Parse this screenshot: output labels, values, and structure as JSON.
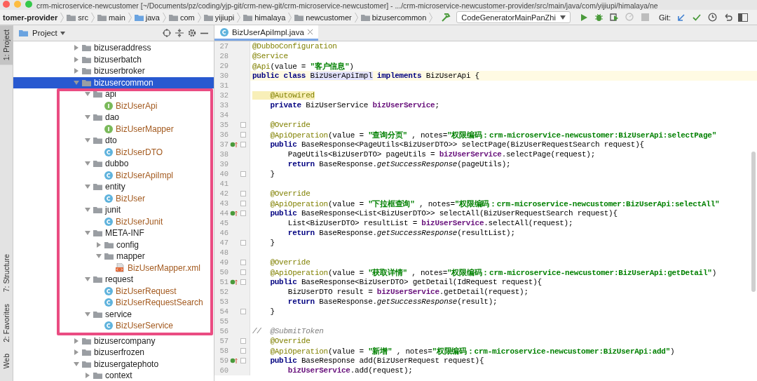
{
  "title_bar": {
    "title": "crm-microservice-newcustomer [~/Documents/pz/coding/yjp-git/crm-new-git/crm-microservice-newcustomer] - .../crm-microservice-newcustomer-provider/src/main/java/com/yijiupi/himalaya/ne"
  },
  "nav_bar": {
    "breadcrumbs": [
      {
        "label": "tomer-provider",
        "kind": "module"
      },
      {
        "label": "src",
        "kind": "folder"
      },
      {
        "label": "main",
        "kind": "folder"
      },
      {
        "label": "java",
        "kind": "source"
      },
      {
        "label": "com",
        "kind": "folder"
      },
      {
        "label": "yijiupi",
        "kind": "folder"
      },
      {
        "label": "himalaya",
        "kind": "folder"
      },
      {
        "label": "newcustomer",
        "kind": "folder"
      },
      {
        "label": "bizusercommon",
        "kind": "folder"
      }
    ],
    "run_config": "CodeGeneratorMainPanZhi",
    "run_tools": [
      {
        "kind": "run",
        "disabled": false
      },
      {
        "kind": "debug",
        "disabled": false
      },
      {
        "kind": "coverage",
        "disabled": false
      },
      {
        "kind": "profile",
        "disabled": true
      },
      {
        "kind": "stop",
        "disabled": true
      }
    ],
    "git_label": "Git:",
    "git_tools": [
      {
        "kind": "update"
      },
      {
        "kind": "commit"
      },
      {
        "kind": "history"
      },
      {
        "kind": "revert"
      },
      {
        "kind": "layout"
      }
    ]
  },
  "side_tabs": [
    {
      "label": "1: Project",
      "selected": true
    },
    {
      "label": "7: Structure",
      "selected": false
    },
    {
      "label": "2: Favorites",
      "selected": false
    },
    {
      "label": "Web",
      "selected": false
    }
  ],
  "project": {
    "title": "Project",
    "tree": [
      {
        "label": "bizuseraddress",
        "kind": "folder",
        "expanded": false,
        "selected": false
      },
      {
        "label": "bizuserbatch",
        "kind": "folder",
        "expanded": false,
        "selected": false
      },
      {
        "label": "bizuserbroker",
        "kind": "folder",
        "expanded": false,
        "selected": false
      },
      {
        "label": "bizusercommon",
        "kind": "folder",
        "expanded": true,
        "selected": true,
        "highlighted": true,
        "children": [
          {
            "label": "api",
            "kind": "folder",
            "expanded": true,
            "selected": false,
            "children": [
              {
                "label": "BizUserApi",
                "kind": "interface",
                "selected": false
              }
            ]
          },
          {
            "label": "dao",
            "kind": "folder",
            "expanded": true,
            "selected": false,
            "children": [
              {
                "label": "BizUserMapper",
                "kind": "interface",
                "selected": false
              }
            ]
          },
          {
            "label": "dto",
            "kind": "folder",
            "expanded": true,
            "selected": false,
            "children": [
              {
                "label": "BizUserDTO",
                "kind": "class",
                "selected": false
              }
            ]
          },
          {
            "label": "dubbo",
            "kind": "folder",
            "expanded": true,
            "selected": false,
            "children": [
              {
                "label": "BizUserApiImpl",
                "kind": "class",
                "selected": false
              }
            ]
          },
          {
            "label": "entity",
            "kind": "folder",
            "expanded": true,
            "selected": false,
            "children": [
              {
                "label": "BizUser",
                "kind": "class",
                "selected": false
              }
            ]
          },
          {
            "label": "junit",
            "kind": "folder",
            "expanded": true,
            "selected": false,
            "children": [
              {
                "label": "BizUserJunit",
                "kind": "class",
                "selected": false
              }
            ]
          },
          {
            "label": "META-INF",
            "kind": "folder",
            "expanded": true,
            "selected": false,
            "children": [
              {
                "label": "config",
                "kind": "folder",
                "expanded": false,
                "selected": false
              },
              {
                "label": "mapper",
                "kind": "folder",
                "expanded": true,
                "selected": false,
                "children": [
                  {
                    "label": "BizUserMapper.xml",
                    "kind": "xml",
                    "selected": false
                  }
                ]
              }
            ]
          },
          {
            "label": "request",
            "kind": "folder",
            "expanded": true,
            "selected": false,
            "children": [
              {
                "label": "BizUserRequest",
                "kind": "class",
                "selected": false
              },
              {
                "label": "BizUserRequestSearch",
                "kind": "class",
                "selected": false
              }
            ]
          },
          {
            "label": "service",
            "kind": "folder",
            "expanded": true,
            "selected": false,
            "children": [
              {
                "label": "BizUserService",
                "kind": "class",
                "selected": false
              }
            ]
          }
        ]
      },
      {
        "label": "bizusercompany",
        "kind": "folder",
        "expanded": false,
        "selected": false
      },
      {
        "label": "bizuserfrozen",
        "kind": "folder",
        "expanded": false,
        "selected": false
      },
      {
        "label": "bizusergatephoto",
        "kind": "folder",
        "expanded": true,
        "selected": false,
        "children": [
          {
            "label": "context",
            "kind": "folder",
            "expanded": false,
            "selected": false
          }
        ]
      }
    ]
  },
  "editor": {
    "tabs": [
      {
        "label": "BizUserApiImpl.java",
        "selected": true
      }
    ],
    "lines": [
      {
        "number": "27",
        "fold": false,
        "current": false,
        "tokens": [
          {
            "kind": "ann",
            "text": "@DubboConfiguration"
          }
        ]
      },
      {
        "number": "28",
        "fold": false,
        "current": false,
        "tokens": [
          {
            "kind": "ann",
            "text": "@Service"
          }
        ]
      },
      {
        "number": "29",
        "fold": false,
        "current": false,
        "tokens": [
          {
            "kind": "ann",
            "text": "@Api"
          },
          {
            "kind": "plain",
            "text": "(value = "
          },
          {
            "kind": "str",
            "text": "\"客户信息\""
          },
          {
            "kind": "plain",
            "text": ")"
          }
        ]
      },
      {
        "number": "30",
        "fold": false,
        "current": true,
        "tokens": [
          {
            "kind": "kw",
            "text": "public class "
          },
          {
            "kind": "ref",
            "text": "BizUserApiImpl"
          },
          {
            "kind": "kw",
            "text": " implements "
          },
          {
            "kind": "plain",
            "text": "BizUserApi {"
          }
        ]
      },
      {
        "number": "31",
        "fold": false,
        "current": false
      },
      {
        "number": "32",
        "fold": false,
        "current": false,
        "tokens": [
          {
            "kind": "flagged",
            "text": "    @Autowired"
          }
        ]
      },
      {
        "number": "33",
        "fold": false,
        "current": false,
        "tokens": [
          {
            "kind": "kw",
            "text": "    private "
          },
          {
            "kind": "plain",
            "text": "BizUserService "
          },
          {
            "kind": "field",
            "text": "bizUserService"
          },
          {
            "kind": "plain",
            "text": ";"
          }
        ]
      },
      {
        "number": "34",
        "fold": false,
        "current": false
      },
      {
        "number": "35",
        "fold": true,
        "current": false,
        "tokens": [
          {
            "kind": "ann",
            "text": "    @Override"
          }
        ]
      },
      {
        "number": "36",
        "fold": true,
        "current": false,
        "tokens": [
          {
            "kind": "ann",
            "text": "    @ApiOperation"
          },
          {
            "kind": "plain",
            "text": "(value = "
          },
          {
            "kind": "str",
            "text": "\"查询分页\""
          },
          {
            "kind": "plain",
            "text": " , notes="
          },
          {
            "kind": "str",
            "text": "\"权限编码：crm-microservice-newcustomer:BizUserApi:selectPage\""
          }
        ]
      },
      {
        "number": "37",
        "fold": true,
        "current": false,
        "override": true,
        "tokens": [
          {
            "kind": "kw",
            "text": "    public "
          },
          {
            "kind": "plain",
            "text": "BaseResponse<PageUtils<BizUserDTO>> selectPage(BizUserRequestSearch request){"
          }
        ]
      },
      {
        "number": "38",
        "fold": false,
        "current": false,
        "tokens": [
          {
            "kind": "plain",
            "text": "        PageUtils<BizUserDTO> pageUtils = "
          },
          {
            "kind": "field",
            "text": "bizUserService"
          },
          {
            "kind": "plain",
            "text": ".selectPage(request);"
          }
        ]
      },
      {
        "number": "39",
        "fold": false,
        "current": false,
        "tokens": [
          {
            "kind": "kw",
            "text": "        return "
          },
          {
            "kind": "plain",
            "text": "BaseResponse."
          },
          {
            "kind": "static",
            "text": "getSuccessResponse"
          },
          {
            "kind": "plain",
            "text": "(pageUtils);"
          }
        ]
      },
      {
        "number": "40",
        "fold": true,
        "current": false,
        "tokens": [
          {
            "kind": "plain",
            "text": "    }"
          }
        ]
      },
      {
        "number": "41",
        "fold": false,
        "current": false
      },
      {
        "number": "42",
        "fold": true,
        "current": false,
        "tokens": [
          {
            "kind": "ann",
            "text": "    @Override"
          }
        ]
      },
      {
        "number": "43",
        "fold": true,
        "current": false,
        "tokens": [
          {
            "kind": "ann",
            "text": "    @ApiOperation"
          },
          {
            "kind": "plain",
            "text": "(value = "
          },
          {
            "kind": "str",
            "text": "\"下拉框查询\""
          },
          {
            "kind": "plain",
            "text": " , notes="
          },
          {
            "kind": "str",
            "text": "\"权限编码：crm-microservice-newcustomer:BizUserApi:selectAll\""
          }
        ]
      },
      {
        "number": "44",
        "fold": true,
        "current": false,
        "override": true,
        "tokens": [
          {
            "kind": "kw",
            "text": "    public "
          },
          {
            "kind": "plain",
            "text": "BaseResponse<List<BizUserDTO>> selectAll(BizUserRequestSearch request){"
          }
        ]
      },
      {
        "number": "45",
        "fold": false,
        "current": false,
        "tokens": [
          {
            "kind": "plain",
            "text": "        List<BizUserDTO> resultList = "
          },
          {
            "kind": "field",
            "text": "bizUserService"
          },
          {
            "kind": "plain",
            "text": ".selectAll(request);"
          }
        ]
      },
      {
        "number": "46",
        "fold": false,
        "current": false,
        "tokens": [
          {
            "kind": "kw",
            "text": "        return "
          },
          {
            "kind": "plain",
            "text": "BaseResponse."
          },
          {
            "kind": "static",
            "text": "getSuccessResponse"
          },
          {
            "kind": "plain",
            "text": "(resultList);"
          }
        ]
      },
      {
        "number": "47",
        "fold": true,
        "current": false,
        "tokens": [
          {
            "kind": "plain",
            "text": "    }"
          }
        ]
      },
      {
        "number": "48",
        "fold": false,
        "current": false
      },
      {
        "number": "49",
        "fold": true,
        "current": false,
        "tokens": [
          {
            "kind": "ann",
            "text": "    @Override"
          }
        ]
      },
      {
        "number": "50",
        "fold": true,
        "current": false,
        "tokens": [
          {
            "kind": "ann",
            "text": "    @ApiOperation"
          },
          {
            "kind": "plain",
            "text": "(value = "
          },
          {
            "kind": "str",
            "text": "\"获取详情\""
          },
          {
            "kind": "plain",
            "text": " , notes="
          },
          {
            "kind": "str",
            "text": "\"权限编码：crm-microservice-newcustomer:BizUserApi:getDetail\""
          },
          {
            "kind": "plain",
            "text": ")"
          }
        ]
      },
      {
        "number": "51",
        "fold": true,
        "current": false,
        "override": true,
        "tokens": [
          {
            "kind": "kw",
            "text": "    public "
          },
          {
            "kind": "plain",
            "text": "BaseResponse<BizUserDTO> getDetail(IdRequest request){"
          }
        ]
      },
      {
        "number": "52",
        "fold": false,
        "current": false,
        "tokens": [
          {
            "kind": "plain",
            "text": "        BizUserDTO result = "
          },
          {
            "kind": "field",
            "text": "bizUserService"
          },
          {
            "kind": "plain",
            "text": ".getDetail(request);"
          }
        ]
      },
      {
        "number": "53",
        "fold": false,
        "current": false,
        "tokens": [
          {
            "kind": "kw",
            "text": "        return "
          },
          {
            "kind": "plain",
            "text": "BaseResponse."
          },
          {
            "kind": "static",
            "text": "getSuccessResponse"
          },
          {
            "kind": "plain",
            "text": "(result);"
          }
        ]
      },
      {
        "number": "54",
        "fold": true,
        "current": false,
        "tokens": [
          {
            "kind": "plain",
            "text": "    }"
          }
        ]
      },
      {
        "number": "55",
        "fold": false,
        "current": false
      },
      {
        "number": "56",
        "fold": false,
        "current": false,
        "tokens": [
          {
            "kind": "comment",
            "text": "//  @SubmitToken"
          }
        ]
      },
      {
        "number": "57",
        "fold": true,
        "current": false,
        "tokens": [
          {
            "kind": "ann",
            "text": "    @Override"
          }
        ]
      },
      {
        "number": "58",
        "fold": true,
        "current": false,
        "tokens": [
          {
            "kind": "ann",
            "text": "    @ApiOperation"
          },
          {
            "kind": "plain",
            "text": "(value = "
          },
          {
            "kind": "str",
            "text": "\"新增\""
          },
          {
            "kind": "plain",
            "text": " , notes="
          },
          {
            "kind": "str",
            "text": "\"权限编码：crm-microservice-newcustomer:BizUserApi:add\""
          },
          {
            "kind": "plain",
            "text": ")"
          }
        ]
      },
      {
        "number": "59",
        "fold": true,
        "current": false,
        "override": true,
        "tokens": [
          {
            "kind": "kw",
            "text": "    public "
          },
          {
            "kind": "plain",
            "text": "BaseResponse add(BizUserRequest request){"
          }
        ]
      },
      {
        "number": "60",
        "fold": false,
        "current": false,
        "tokens": [
          {
            "kind": "field",
            "text": "        bizUserService"
          },
          {
            "kind": "plain",
            "text": ".add(request);"
          }
        ]
      }
    ]
  }
}
